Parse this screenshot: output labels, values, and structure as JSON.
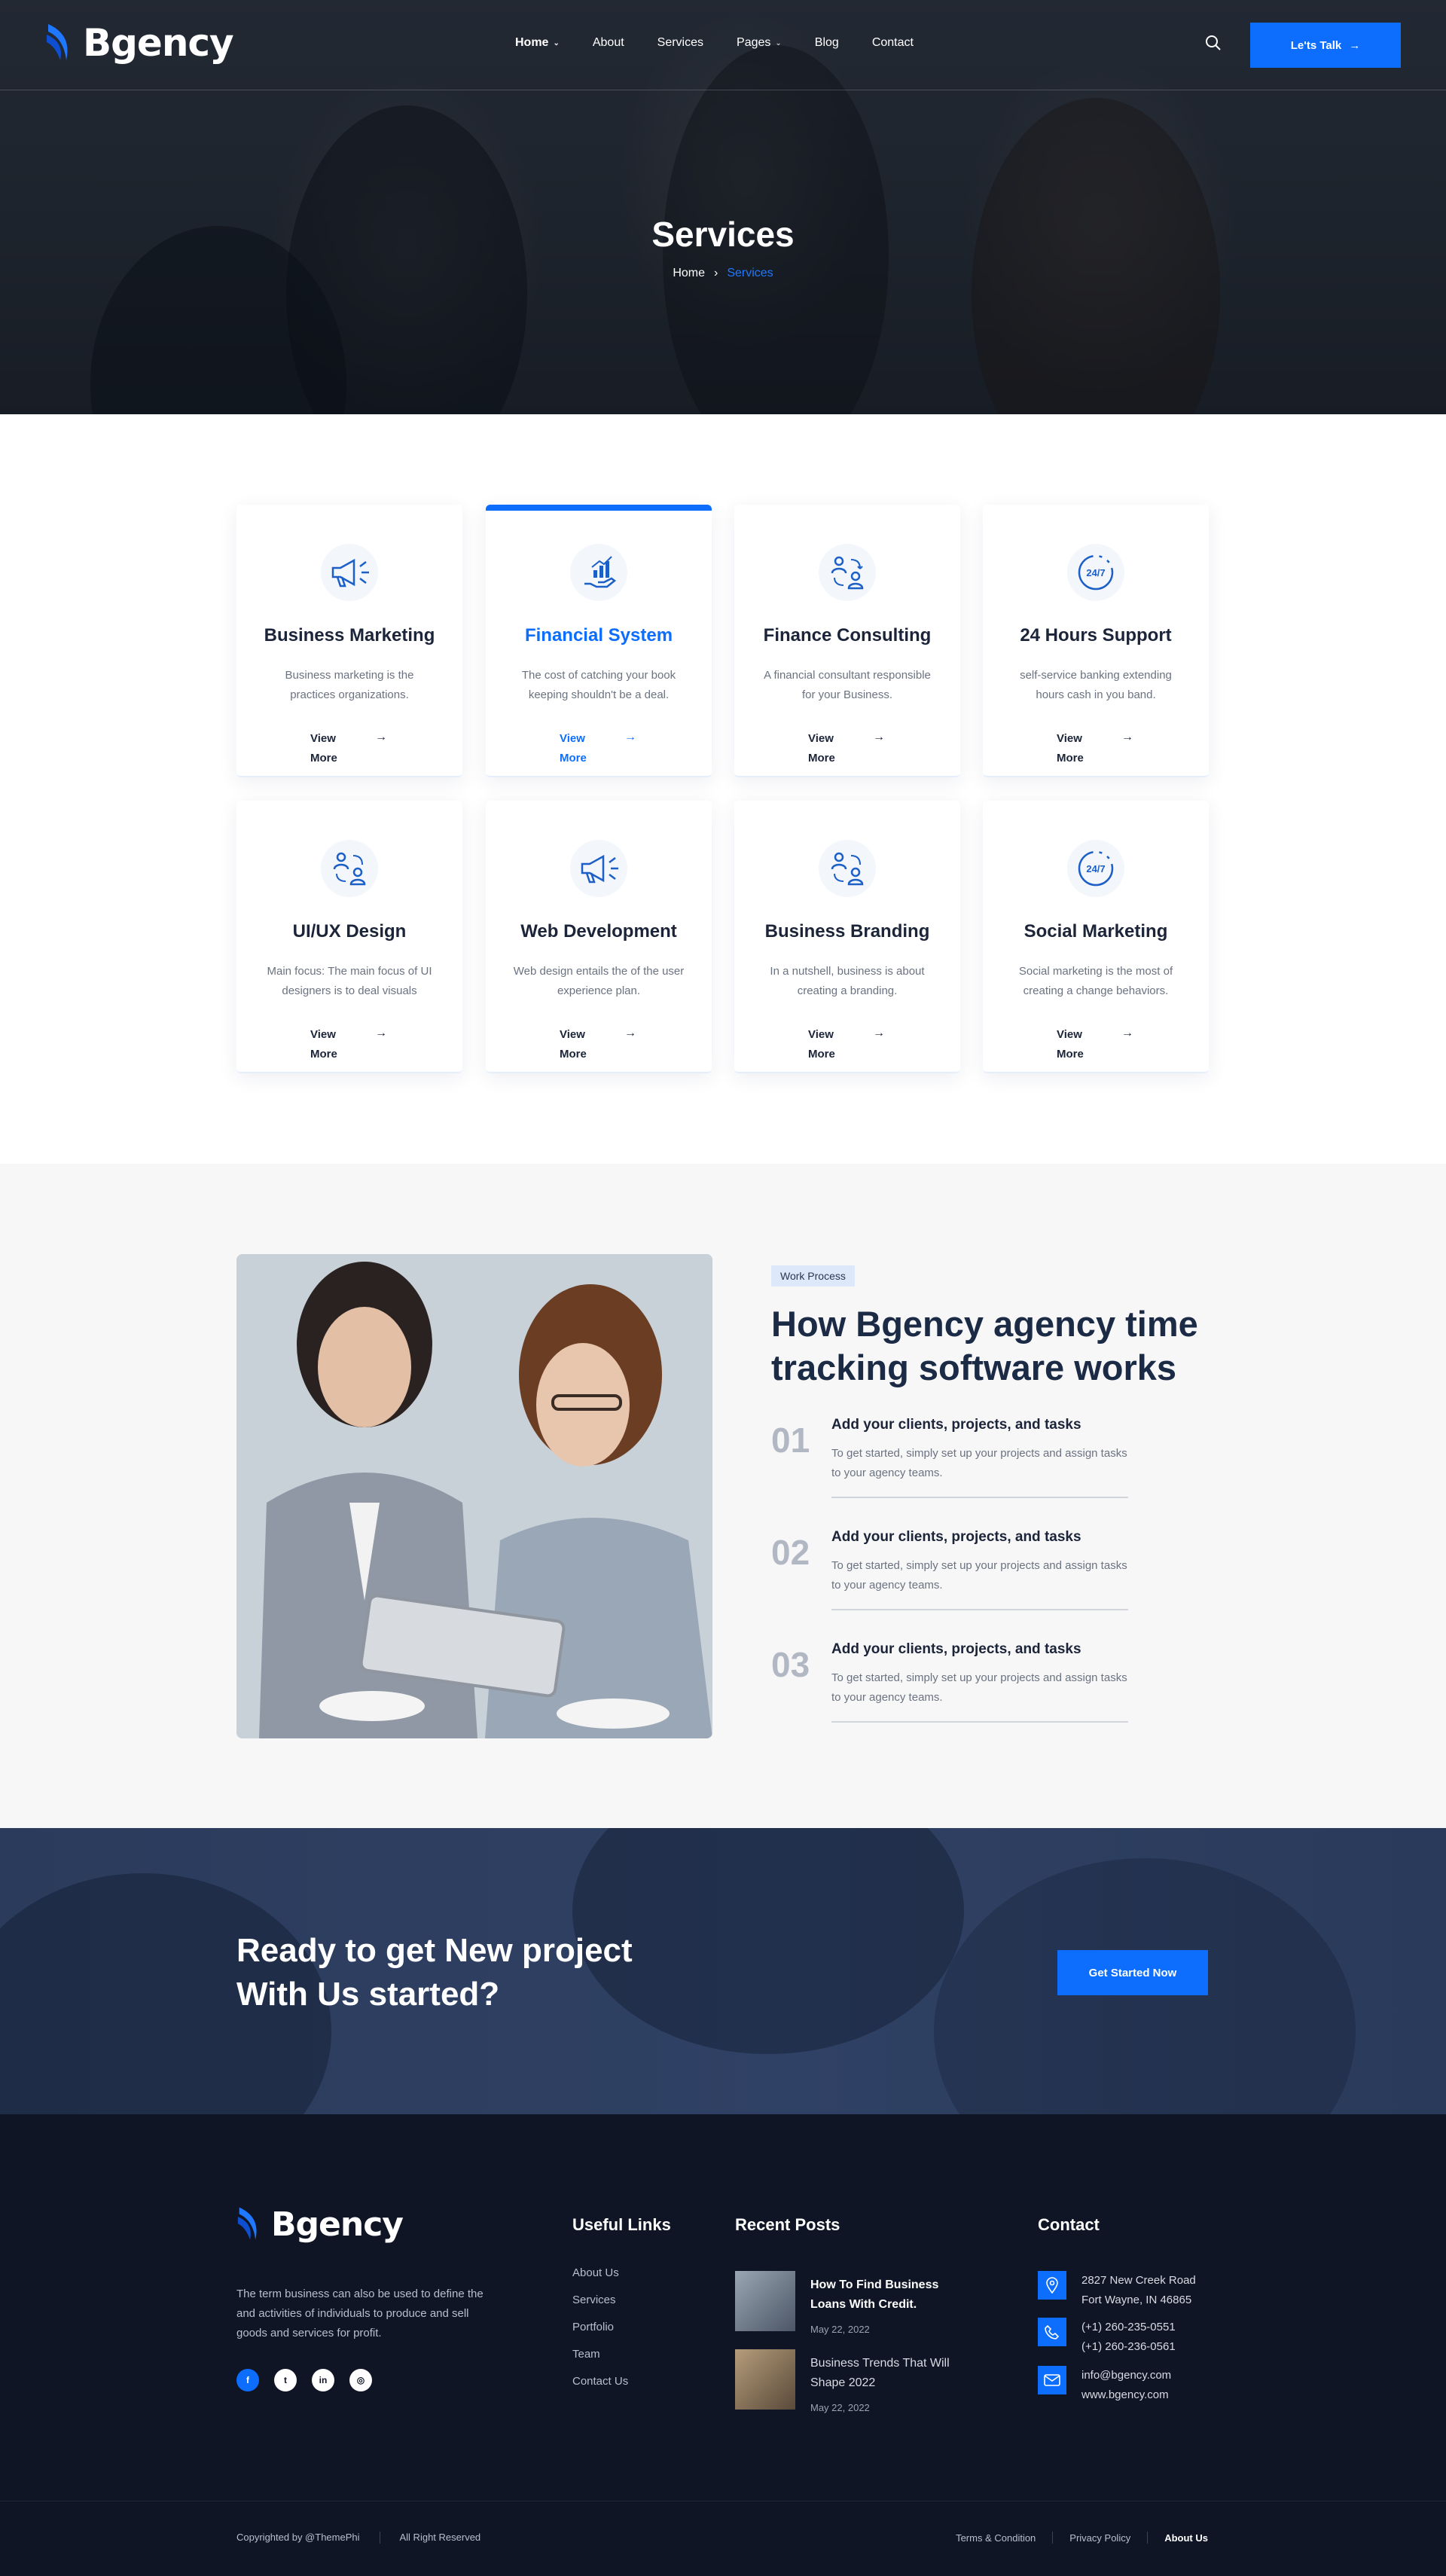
{
  "brand": {
    "name": "Bgency",
    "accent": "#0d6efd",
    "dark": "#0f1524"
  },
  "header": {
    "nav": [
      {
        "label": "Home",
        "has_dropdown": true,
        "active": true
      },
      {
        "label": "About",
        "has_dropdown": false
      },
      {
        "label": "Services",
        "has_dropdown": false
      },
      {
        "label": "Pages",
        "has_dropdown": true
      },
      {
        "label": "Blog",
        "has_dropdown": false
      },
      {
        "label": "Contact",
        "has_dropdown": false
      }
    ],
    "cta_label": "Le'ts Talk",
    "search_icon": "search-icon"
  },
  "hero": {
    "title": "Services",
    "breadcrumb": {
      "home": "Home",
      "separator": "›",
      "current": "Services"
    }
  },
  "services": {
    "cards": [
      {
        "title": "Business Marketing",
        "desc": "Business marketing is the practices organizations.",
        "link": "View More",
        "icon": "megaphone-icon"
      },
      {
        "title": "Financial System",
        "desc": "The cost of catching your book keeping shouldn't be a deal.",
        "link": "View More",
        "icon": "growth-chart-hand-icon",
        "featured": true
      },
      {
        "title": "Finance Consulting",
        "desc": "A financial consultant responsible for your Business.",
        "link": "View More",
        "icon": "consulting-people-icon"
      },
      {
        "title": "24 Hours Support",
        "desc": "self-service banking extending hours cash in you band.",
        "link": "View More",
        "icon": "support-24-7-icon"
      },
      {
        "title": "UI/UX Design",
        "desc": "Main focus: The main focus of UI designers is to deal visuals",
        "link": "View More",
        "icon": "consulting-people-icon"
      },
      {
        "title": "Web Development",
        "desc": "Web design entails the of the user experience plan.",
        "link": "View More",
        "icon": "megaphone-icon"
      },
      {
        "title": "Business Branding",
        "desc": "In a nutshell, business is about creating a branding.",
        "link": "View More",
        "icon": "consulting-people-icon"
      },
      {
        "title": "Social Marketing",
        "desc": "Social marketing is the most of creating a change behaviors.",
        "link": "View More",
        "icon": "support-24-7-icon"
      }
    ],
    "support_glyph": "24/7"
  },
  "process": {
    "tag": "Work Process",
    "title": "How Bgency agency time tracking software works",
    "steps": [
      {
        "num": "01",
        "title": "Add your clients, projects, and tasks",
        "desc": "To get started, simply set up your projects and assign tasks to your agency teams."
      },
      {
        "num": "02",
        "title": "Add your clients, projects, and tasks",
        "desc": "To get started, simply set up your projects and assign tasks to your agency teams."
      },
      {
        "num": "03",
        "title": "Add your clients, projects, and tasks",
        "desc": "To get started, simply set up your projects and assign tasks to your agency teams."
      }
    ]
  },
  "cta": {
    "title": "Ready to get New project With Us started?",
    "button": "Get Started Now"
  },
  "footer": {
    "about": "The term business can also be used to define the and activities of individuals to produce and sell goods and services for profit.",
    "socials": [
      {
        "icon": "facebook-icon",
        "glyph": "f"
      },
      {
        "icon": "twitter-icon",
        "glyph": "t"
      },
      {
        "icon": "linkedin-icon",
        "glyph": "in"
      },
      {
        "icon": "instagram-icon",
        "glyph": "◎"
      }
    ],
    "useful_links_title": "Useful Links",
    "useful_links": [
      "About Us",
      "Services",
      "Portfolio",
      "Team",
      "Contact Us"
    ],
    "recent_posts_title": "Recent Posts",
    "recent_posts": [
      {
        "title": "How To Find Business Loans With Credit.",
        "date": "May 22, 2022"
      },
      {
        "title": "Business Trends That Will Shape 2022",
        "date": "May 22, 2022"
      }
    ],
    "contact_title": "Contact",
    "contact": {
      "address_line1": "2827 New Creek Road",
      "address_line2": "Fort Wayne, IN 46865",
      "phone1": "(+1) 260-235-0551",
      "phone2": "(+1) 260-236-0561",
      "email": "info@bgency.com",
      "website": "www.bgency.com"
    },
    "copyright": "Copyrighted by @ThemePhi",
    "rights": "All Right Reserved",
    "bottom_links": [
      "Terms & Condition",
      "Privacy Policy",
      "About Us"
    ]
  }
}
